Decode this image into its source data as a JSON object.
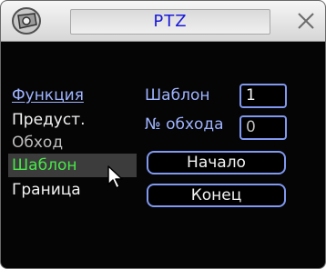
{
  "window": {
    "title": "PTZ"
  },
  "menu": {
    "header": "Функция",
    "items": [
      "Предуст.",
      "Обход",
      "Шаблон",
      "Граница"
    ],
    "selected": "Шаблон"
  },
  "fields": {
    "pattern_label": "Шаблон",
    "pattern_value": "1",
    "tour_label": "№ обхода",
    "tour_value": "0"
  },
  "buttons": {
    "start": "Начало",
    "end": "Конец"
  },
  "colors": {
    "title_text": "#1a1ad8",
    "label": "#9fb3ff",
    "selected_item": "#49e849",
    "border": "#8098f0",
    "background": "#050505"
  },
  "icons": {
    "logo": "camera-logo-icon",
    "close": "close-icon",
    "cursor": "mouse-pointer-icon"
  }
}
